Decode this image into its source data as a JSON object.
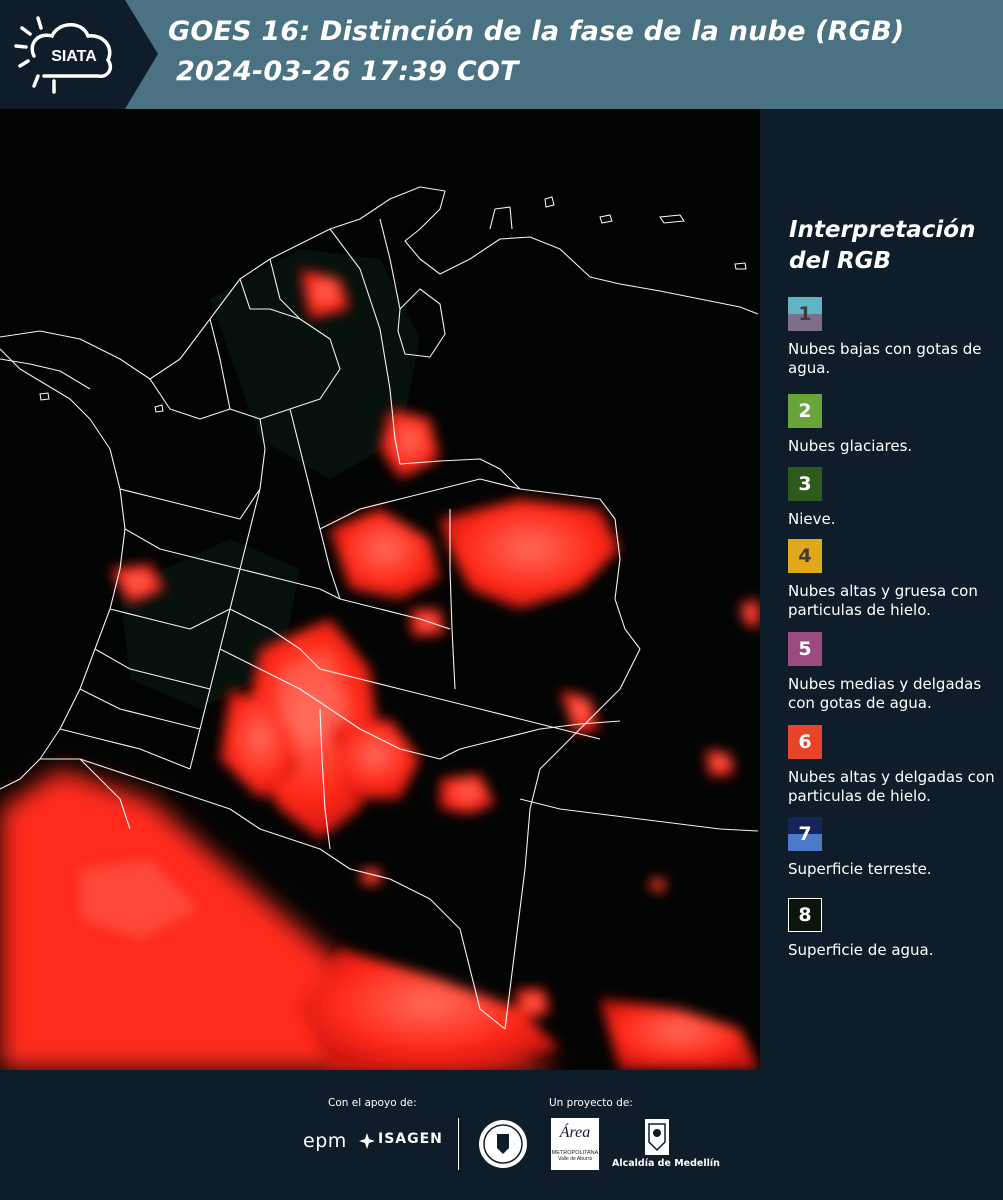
{
  "header": {
    "logo_text": "SIATA",
    "title_line1": "GOES 16: Distinción de la fase de la nube (RGB)",
    "title_line2": "2024-03-26 17:39 COT"
  },
  "colors": {
    "header_bg": "#4b7282",
    "header_dark": "#0f1d2a",
    "panel_bg": "#0f1d2a",
    "cloud_red": "#ff2a1a"
  },
  "legend": {
    "title_line1": "Interpretación",
    "title_line2": "del RGB",
    "items": [
      {
        "number": "1",
        "label": "Nubes bajas con gotas de agua.",
        "color_top": "#5fb4c6",
        "color_bottom": "#7d6f8c",
        "num_color": "#3b3b3b"
      },
      {
        "number": "2",
        "label": "Nubes glaciares.",
        "color_top": "#6aa33a",
        "color_bottom": "#6aa33a",
        "num_color": "#ffffff"
      },
      {
        "number": "3",
        "label": "Nieve.",
        "color_top": "#2e5a1e",
        "color_bottom": "#2e5a1e",
        "num_color": "#ffffff"
      },
      {
        "number": "4",
        "label": "Nubes altas y gruesa con particulas de hielo.",
        "color_top": "#e0a81a",
        "color_bottom": "#e0a81a",
        "num_color": "#3b3b3b"
      },
      {
        "number": "5",
        "label": "Nubes medias y delgadas con gotas de agua.",
        "color_top": "#9a4a7e",
        "color_bottom": "#9a4a7e",
        "num_color": "#ffffff"
      },
      {
        "number": "6",
        "label": "Nubes altas y delgadas con particulas de hielo.",
        "color_top": "#e8442a",
        "color_bottom": "#e8442a",
        "num_color": "#ffffff"
      },
      {
        "number": "7",
        "label": "Superficie terreste.",
        "color_top": "#16245e",
        "color_bottom": "#4a7ac8",
        "num_color": "#ffffff"
      },
      {
        "number": "8",
        "label": "Superficie de agua.",
        "color_top": "#0d130d",
        "color_bottom": "#0d130d",
        "num_color": "#ffffff"
      }
    ]
  },
  "footer": {
    "support_label": "Con el apoyo de:",
    "project_label": "Un proyecto de:",
    "sponsor1": "epm",
    "sponsor2": "ISAGEN",
    "metro_line1": "Área",
    "metro_line2": "METROPOLITANA",
    "metro_line3": "Valle de Aburrá",
    "alcaldia": "Alcaldía de Medellín"
  }
}
